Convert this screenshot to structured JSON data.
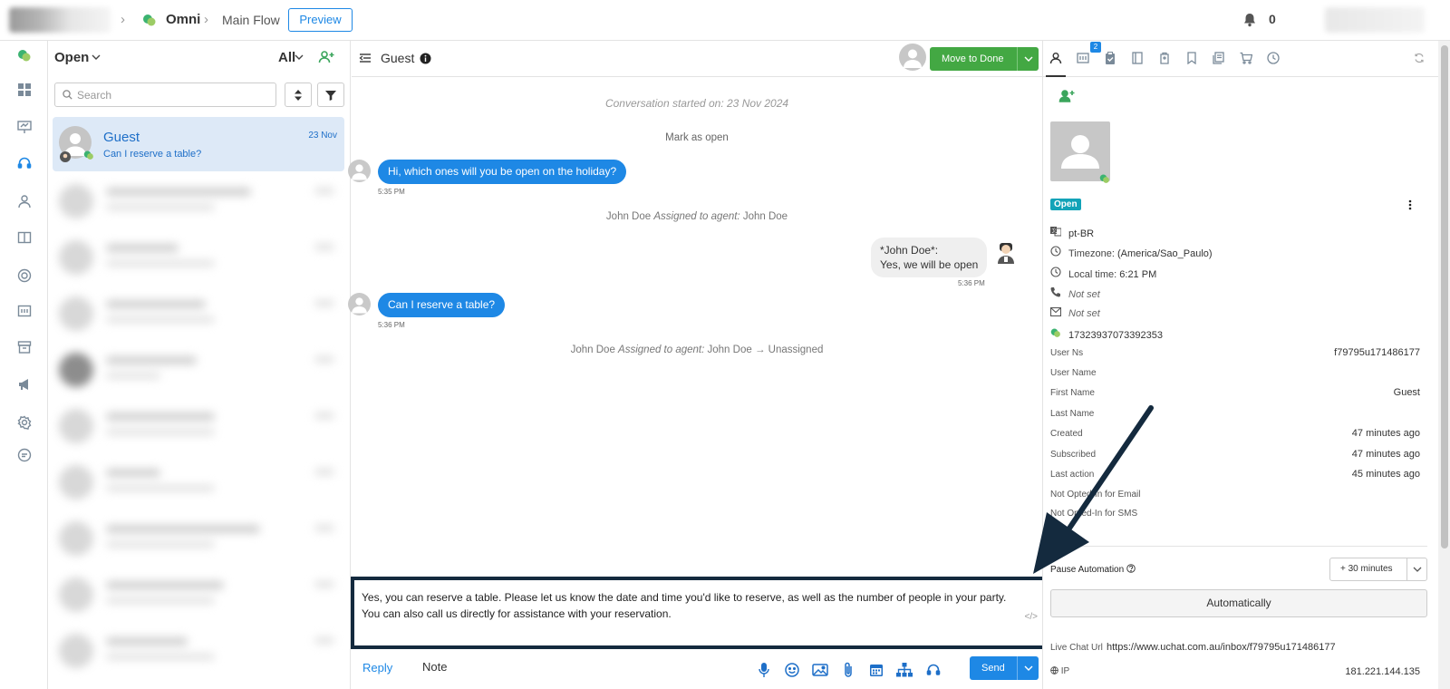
{
  "breadcrumb": {
    "app": "Omni",
    "flow": "Main Flow",
    "preview_label": "Preview"
  },
  "notifications": {
    "count": "0"
  },
  "conversation_list": {
    "status_filter": "Open",
    "scope_filter": "All",
    "search_placeholder": "Search",
    "active": {
      "name": "Guest",
      "preview": "Can I reserve a table?",
      "date": "23 Nov"
    }
  },
  "chat": {
    "contact_name": "Guest",
    "move_to_done_label": "Move to Done",
    "started_on": "Conversation started on: 23 Nov 2024",
    "mark_open": "Mark as open",
    "messages": [
      {
        "text": "Hi, which ones will you be open on the holiday?",
        "time": "5:35 PM"
      },
      {
        "line1": "*John Doe*:",
        "line2": "Yes, we will be open",
        "time": "5:36 PM"
      },
      {
        "text": "Can I reserve a table?",
        "time": "5:36 PM"
      }
    ],
    "assign1": {
      "actor": "John Doe",
      "action": "Assigned to agent:",
      "target": "John Doe"
    },
    "assign2": {
      "actor": "John Doe",
      "action": "Assigned to agent:",
      "target": "John Doe → Unassigned"
    },
    "composer_text_1": "Yes, you can reserve a table. Please let us know the date and time you'd like to reserve, as well as the number of people in your party.",
    "composer_text_2": "You can also call us directly for assistance with your reservation.",
    "code_toggle": "</>",
    "tab_reply": "Reply",
    "tab_note": "Note",
    "send_label": "Send"
  },
  "profile": {
    "tab_badge": "2",
    "status": "Open",
    "language": "pt-BR",
    "timezone_label": "Timezone:",
    "timezone_value": "(America/Sao_Paulo)",
    "localtime_label": "Local time:",
    "localtime_value": "6:21 PM",
    "phone": "Not set",
    "email": "Not set",
    "channel_id": "17323937073392353",
    "fields": [
      {
        "label": "User Ns",
        "value": "f79795u171486177"
      },
      {
        "label": "User Name",
        "value": ""
      },
      {
        "label": "First Name",
        "value": "Guest"
      },
      {
        "label": "Last Name",
        "value": ""
      },
      {
        "label": "Created",
        "value": "47 minutes ago"
      },
      {
        "label": "Subscribed",
        "value": "47 minutes ago"
      },
      {
        "label": "Last action",
        "value": "45 minutes ago"
      },
      {
        "label": "Not Opted-In for Email",
        "value": ""
      },
      {
        "label": "Not Opted-In for SMS",
        "value": ""
      }
    ],
    "pause_automation_label": "Pause Automation",
    "pause_duration": "+ 30 minutes",
    "automatically_label": "Automatically",
    "live_chat_url_label": "Live Chat Url",
    "live_chat_url": "https://www.uchat.com.au/inbox/f79795u171486177",
    "ip_label": "IP",
    "ip_value": "181.221.144.135"
  },
  "colors": {
    "accent": "#1e88e5",
    "done_green": "#43a843",
    "status_teal": "#12a3b8",
    "annotation_navy": "#142a3e"
  }
}
